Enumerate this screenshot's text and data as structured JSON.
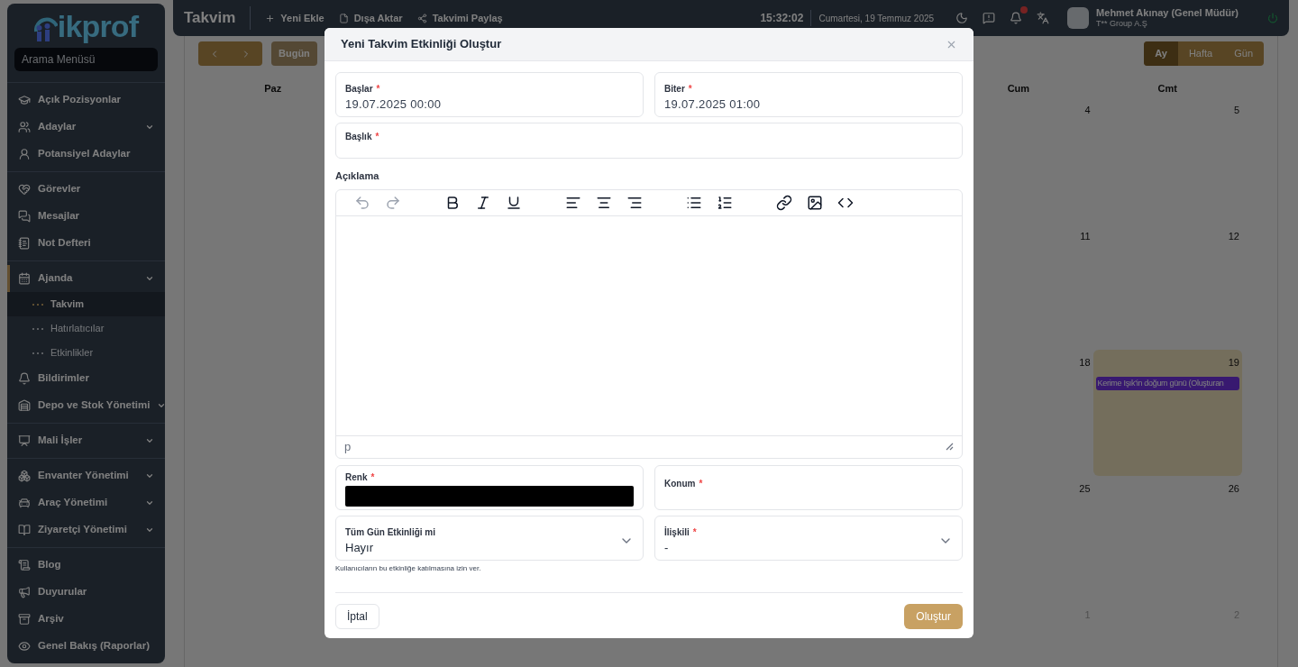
{
  "sidebar": {
    "logo": "ikprof",
    "search": {
      "placeholder": "Arama Menüsü"
    },
    "groups": [
      {
        "items": [
          {
            "label": "Açık Pozisyonlar",
            "expandable": false
          },
          {
            "label": "Adaylar",
            "expandable": true
          },
          {
            "label": "Potansiyel Adaylar",
            "expandable": false
          }
        ]
      },
      {
        "items": [
          {
            "label": "Görevler",
            "expandable": false
          },
          {
            "label": "Mesajlar",
            "expandable": false
          },
          {
            "label": "Not Defteri",
            "expandable": false
          }
        ]
      },
      {
        "items": [
          {
            "label": "Ajanda",
            "expandable": true,
            "expanded": true,
            "children": [
              {
                "label": "Takvim",
                "selected": true
              },
              {
                "label": "Hatırlatıcılar",
                "selected": false
              },
              {
                "label": "Etkinlikler",
                "selected": false
              }
            ]
          },
          {
            "label": "Bildirimler",
            "expandable": false
          },
          {
            "label": "Depo ve Stok Yönetimi",
            "expandable": true
          }
        ]
      },
      {
        "items": [
          {
            "label": "Mali İşler",
            "expandable": true
          }
        ]
      },
      {
        "items": [
          {
            "label": "Envanter Yönetimi",
            "expandable": true
          },
          {
            "label": "Araç Yönetimi",
            "expandable": true
          },
          {
            "label": "Ziyaretçi Yönetimi",
            "expandable": true
          }
        ]
      },
      {
        "items": [
          {
            "label": "Blog",
            "expandable": false
          },
          {
            "label": "Duyurular",
            "expandable": false
          },
          {
            "label": "Arşiv",
            "expandable": false
          },
          {
            "label": "Genel Bakış (Raporlar)",
            "expandable": false
          }
        ]
      }
    ]
  },
  "topbar": {
    "title": "Takvim",
    "actions": [
      "Yeni Ekle",
      "Dışa Aktar",
      "Takvimi Paylaş"
    ],
    "time": "15:32:02",
    "date": "Cumartesi, 19 Temmuz 2025",
    "notification_dot": true,
    "user": {
      "name": "Mehmet Akınay (Genel Müdür)",
      "company": "T** Group A.Ş"
    }
  },
  "calendar": {
    "today_button": "Bugün",
    "views": [
      {
        "label": "Ay",
        "selected": true
      },
      {
        "label": "Hafta",
        "selected": false
      },
      {
        "label": "Gün",
        "selected": false
      }
    ],
    "weekdays": [
      "Paz",
      "Cum",
      "Cmt"
    ],
    "weeks": [
      {
        "outside": false,
        "cells": [
          {
            "day": "4",
            "today": false
          },
          {
            "day": "5",
            "today": false
          }
        ]
      },
      {
        "outside": false,
        "cells": [
          {
            "day": "11",
            "today": false
          },
          {
            "day": "12",
            "today": false
          }
        ]
      },
      {
        "outside": false,
        "cells": [
          {
            "day": "18",
            "today": false
          },
          {
            "day": "19",
            "today": true,
            "events": [
              "Kerime Işık'in doğum günü (Oluşturan"
            ]
          }
        ]
      },
      {
        "outside": false,
        "cells": [
          {
            "day": "25",
            "today": false
          },
          {
            "day": "26",
            "today": false
          }
        ]
      },
      {
        "outside": true,
        "cells": [
          {
            "day": "1",
            "today": false
          },
          {
            "day": "2",
            "today": false
          }
        ]
      }
    ]
  },
  "modal": {
    "title": "Yeni Takvim Etkinliği Oluştur",
    "start": {
      "label": "Başlar",
      "required_mark": "*",
      "value": "19.07.2025 00:00"
    },
    "end": {
      "label": "Biter",
      "required_mark": "*",
      "value": "19.07.2025 01:00"
    },
    "subject": {
      "label": "Başlık",
      "required_mark": "*"
    },
    "description": {
      "label": "Açıklama",
      "tools": [
        {
          "kind": "undo",
          "disabled": true
        },
        {
          "kind": "redo",
          "disabled": true
        },
        {
          "kind": "bold",
          "disabled": false
        },
        {
          "kind": "italic",
          "disabled": false
        },
        {
          "kind": "underline",
          "disabled": false
        },
        {
          "kind": "align-left",
          "disabled": false
        },
        {
          "kind": "align-center",
          "disabled": false
        },
        {
          "kind": "align-right",
          "disabled": false
        },
        {
          "kind": "bullets",
          "disabled": false
        },
        {
          "kind": "numbers",
          "disabled": false
        },
        {
          "kind": "link",
          "disabled": false
        },
        {
          "kind": "image",
          "disabled": false
        },
        {
          "kind": "code",
          "disabled": false
        }
      ],
      "path": "p"
    },
    "color": {
      "label": "Renk",
      "required_mark": "*",
      "color": "#000000"
    },
    "location": {
      "label": "Konum",
      "required_mark": "*"
    },
    "all_day": {
      "label": "Tüm Gün Etkinliği mi",
      "value": "Hayır",
      "hint": "Kullanıcıların bu etkinliğe katılmasına izin ver."
    },
    "related": {
      "label": "İlişkili",
      "required_mark": "*",
      "value": "-"
    },
    "cancel": "İptal",
    "submit": "Oluştur"
  }
}
